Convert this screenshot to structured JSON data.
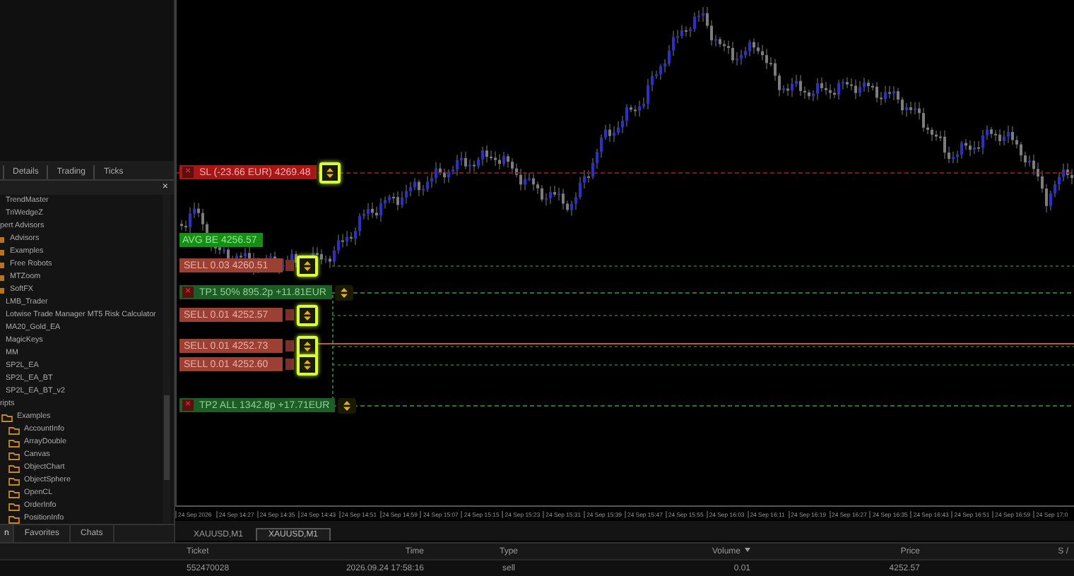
{
  "navigator": {
    "tabs": [
      {
        "label": "Details",
        "selected": false
      },
      {
        "label": "Trading",
        "selected": false
      },
      {
        "label": "Ticks",
        "selected": false
      }
    ],
    "close": "×",
    "tree": [
      {
        "label": "TrendMaster",
        "kind": "file"
      },
      {
        "label": "TriWedgeZ",
        "kind": "file"
      },
      {
        "label": "pert Advisors",
        "kind": "group",
        "children": [
          {
            "label": "Advisors",
            "kind": "ea"
          },
          {
            "label": "Examples",
            "kind": "ea"
          },
          {
            "label": "Free Robots",
            "kind": "ea"
          },
          {
            "label": "MTZoom",
            "kind": "ea"
          },
          {
            "label": "SoftFX",
            "kind": "ea"
          },
          {
            "label": "LMB_Trader",
            "kind": "file"
          },
          {
            "label": "Lotwise Trade Manager MT5 Risk Calculator",
            "kind": "file"
          },
          {
            "label": "MA20_Gold_EA",
            "kind": "file"
          },
          {
            "label": "MagicKeys",
            "kind": "file"
          },
          {
            "label": "MM",
            "kind": "file"
          },
          {
            "label": "SP2L_EA",
            "kind": "file"
          },
          {
            "label": "SP2L_EA_BT",
            "kind": "file"
          },
          {
            "label": "SP2L_EA_BT_v2",
            "kind": "file"
          }
        ]
      },
      {
        "label": "ripts",
        "kind": "group",
        "children": [
          {
            "label": "Examples",
            "kind": "folder",
            "children": [
              {
                "label": "AccountInfo",
                "kind": "folder"
              },
              {
                "label": "ArrayDouble",
                "kind": "folder"
              },
              {
                "label": "Canvas",
                "kind": "folder"
              },
              {
                "label": "ObjectChart",
                "kind": "folder"
              },
              {
                "label": "ObjectSphere",
                "kind": "folder"
              },
              {
                "label": "OpenCL",
                "kind": "folder"
              },
              {
                "label": "OrderInfo",
                "kind": "folder"
              },
              {
                "label": "PositionInfo",
                "kind": "folder"
              }
            ]
          }
        ]
      }
    ],
    "bottom_tabs": [
      {
        "label": "n",
        "selected": true
      },
      {
        "label": "Favorites",
        "selected": false
      },
      {
        "label": "Chats",
        "selected": false
      }
    ]
  },
  "chart": {
    "levels": [
      {
        "kind": "sl",
        "text": "SL (-23.66 EUR) 4269.48",
        "close": "×",
        "handle_highlighted": true
      },
      {
        "kind": "avg",
        "text": "AVG BE 4256.57"
      },
      {
        "kind": "sell",
        "text": "SELL 0.03 4260.51",
        "handle_highlighted": true
      },
      {
        "kind": "tp",
        "text": "TP1 50% 895.2p +11.81EUR",
        "close": "×",
        "handle_highlighted": false
      },
      {
        "kind": "sell",
        "text": "SELL 0.01 4252.57",
        "handle_highlighted": true
      },
      {
        "kind": "sell",
        "text": "SELL 0.01 4252.73",
        "handle_highlighted": true
      },
      {
        "kind": "sell",
        "text": "SELL 0.01 4252.60",
        "handle_highlighted": true
      },
      {
        "kind": "tp",
        "text": "TP2 ALL 1342.8p +17.71EUR",
        "close": "×",
        "handle_highlighted": false
      }
    ],
    "time_axis": [
      "24 Sep 2026",
      "24 Sep 14:27",
      "24 Sep 14:35",
      "24 Sep 14:43",
      "24 Sep 14:51",
      "24 Sep 14:59",
      "24 Sep 15:07",
      "24 Sep 15:15",
      "24 Sep 15:23",
      "24 Sep 15:31",
      "24 Sep 15:39",
      "24 Sep 15:47",
      "24 Sep 15:55",
      "24 Sep 16:03",
      "24 Sep 16:11",
      "24 Sep 16:19",
      "24 Sep 16:27",
      "24 Sep 16:35",
      "24 Sep 16:43",
      "24 Sep 16:51",
      "24 Sep 16:59",
      "24 Sep 17:0"
    ],
    "tabs": [
      {
        "label": "XAUUSD,M1",
        "selected": false
      },
      {
        "label": "XAUUSD,M1",
        "selected": true
      }
    ]
  },
  "trades": {
    "columns": [
      "Ticket",
      "Time",
      "Type",
      "Volume",
      "Price",
      "S /"
    ],
    "rows": [
      [
        "552470028",
        "2026.09.24 17:58:16",
        "sell",
        "0.01",
        "4252.57"
      ]
    ]
  }
}
